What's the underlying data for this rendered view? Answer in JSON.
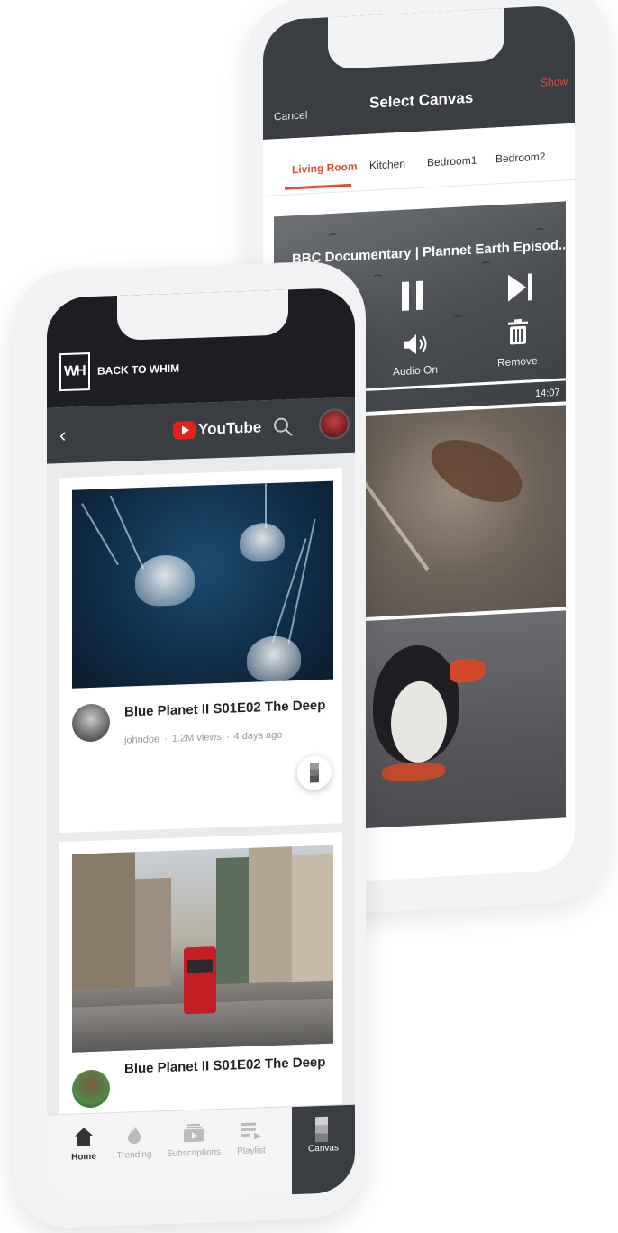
{
  "back_screen": {
    "cancel_label": "Cancel",
    "title": "Select Canvas",
    "show_label": "Show",
    "rooms": [
      {
        "label": "Living Room",
        "active": true
      },
      {
        "label": "Kitchen",
        "active": false
      },
      {
        "label": "Bedroom1",
        "active": false
      },
      {
        "label": "Bedroom2",
        "active": false
      }
    ],
    "now_playing": {
      "title": "BBC Documentary | Plannet Earth Episod...",
      "audio_label": "Audio On",
      "remove_label": "Remove",
      "duration": "14:07"
    },
    "accent_color": "#e24b3b"
  },
  "front_screen": {
    "back_to_whim": "BACK TO WHIM",
    "logo_text": "WH",
    "youtube_wordmark": "YouTube",
    "videos": [
      {
        "title": "Blue Planet II S01E02 The Deep",
        "channel": "johndoe",
        "views": "1.2M views",
        "age": "4 days ago"
      },
      {
        "title": "Blue Planet II S01E02 The Deep"
      }
    ],
    "nav": [
      {
        "label": "Home",
        "icon": "home-icon",
        "active": true
      },
      {
        "label": "Trending",
        "icon": "flame-icon",
        "active": false
      },
      {
        "label": "Subscriptions",
        "icon": "subscriptions-icon",
        "active": false
      },
      {
        "label": "Playlist",
        "icon": "playlist-icon",
        "active": false
      },
      {
        "label": "Canvas",
        "icon": "canvas-icon",
        "active": false
      }
    ],
    "youtube_red": "#e62117"
  }
}
